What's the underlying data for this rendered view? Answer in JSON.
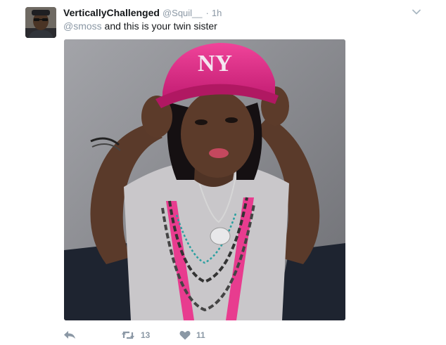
{
  "tweet": {
    "display_name": "VerticallyChallenged",
    "handle": "@Squil__",
    "separator": "·",
    "time": "1h",
    "mention": "@smoss",
    "text": " and this is your twin sister",
    "reply_icon": "reply-icon",
    "retweet_icon": "retweet-icon",
    "like_icon": "heart-icon",
    "more_icon": "chevron-down-icon",
    "retweet_count": "13",
    "like_count": "11"
  },
  "colors": {
    "text": "#14171a",
    "muted": "#8b98a5",
    "icon": "#8b98a5"
  }
}
